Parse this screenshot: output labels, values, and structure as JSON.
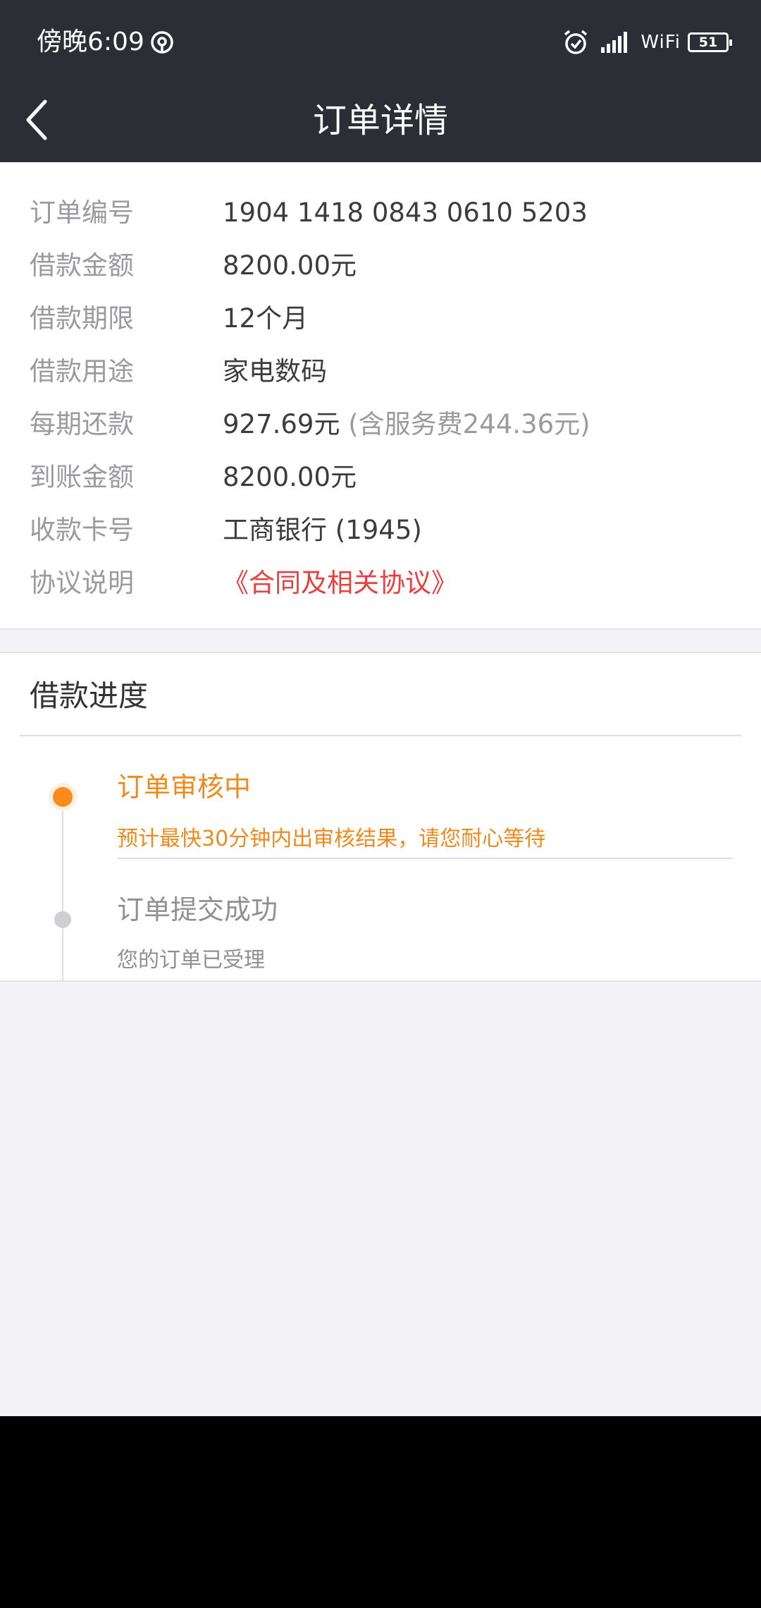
{
  "status_bar": {
    "time": "傍晚6:09",
    "wifi_label": "WiFi",
    "battery_level": "51",
    "icons": [
      "hotspot-icon",
      "alarm-icon",
      "signal-icon",
      "battery-icon"
    ]
  },
  "nav": {
    "title": "订单详情",
    "back_icon": "chevron-left-icon"
  },
  "order_info": {
    "rows": [
      {
        "label": "订单编号",
        "value": "1904 1418 0843 0610 5203"
      },
      {
        "label": "借款金额",
        "value": "8200.00元"
      },
      {
        "label": "借款期限",
        "value": "12个月"
      },
      {
        "label": "借款用途",
        "value": "家电数码"
      },
      {
        "label": "每期还款",
        "value": "927.69元",
        "note": " (含服务费244.36元)"
      },
      {
        "label": "到账金额",
        "value": "8200.00元"
      },
      {
        "label": "收款卡号",
        "value": "工商银行 (1945)"
      },
      {
        "label": "协议说明",
        "value": "《合同及相关协议》"
      }
    ]
  },
  "progress": {
    "title": "借款进度",
    "steps": [
      {
        "title": "订单审核中",
        "desc": "预计最快30分钟内出审核结果，请您耐心等待",
        "state": "active"
      },
      {
        "title": "订单提交成功",
        "desc": "您的订单已受理",
        "state": "done"
      }
    ]
  },
  "colors": {
    "header_bg": "#2b2e34",
    "page_bg": "#f2f2f7",
    "accent_orange": "#f08a1c",
    "link_red": "#ea3f3f",
    "label_gray": "#9a9a9f"
  }
}
